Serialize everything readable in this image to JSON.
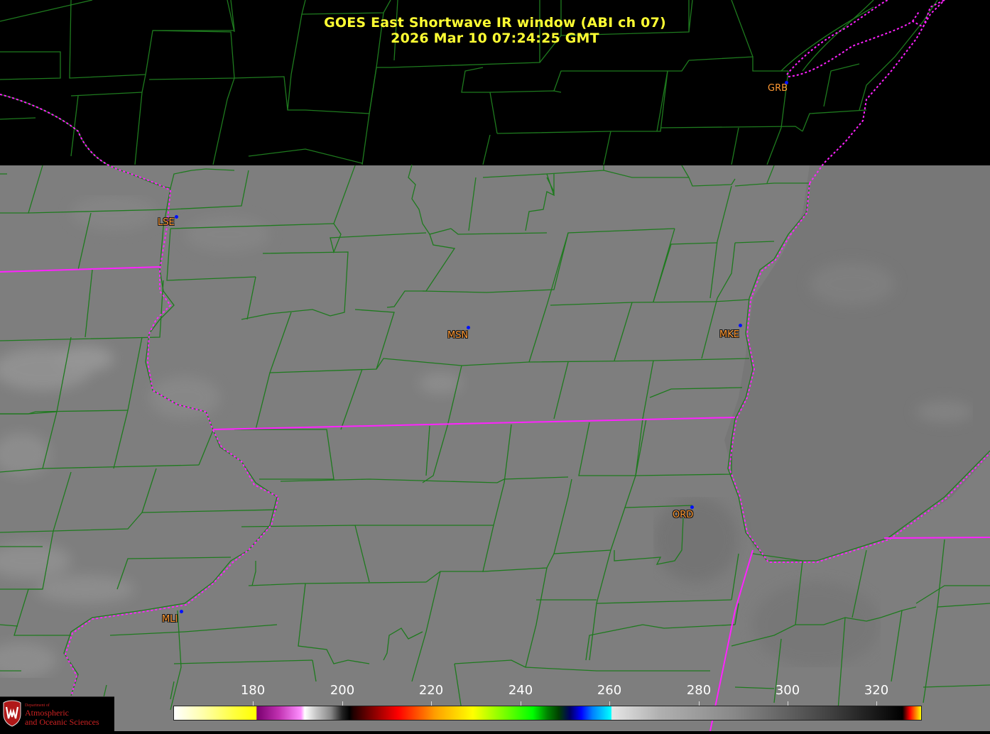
{
  "header": {
    "title": "GOES East Shortwave IR window (ABI ch 07)",
    "timestamp": "2026 Mar 10  07:24:25 GMT"
  },
  "stations": [
    {
      "id": "GRB",
      "label": "GRB"
    },
    {
      "id": "LSE",
      "label": "LSE"
    },
    {
      "id": "MSN",
      "label": "MSN"
    },
    {
      "id": "MKE",
      "label": "MKE"
    },
    {
      "id": "ORD",
      "label": "ORD"
    },
    {
      "id": "MLI",
      "label": "MLI"
    }
  ],
  "colorbar": {
    "ticks": [
      "180",
      "200",
      "220",
      "240",
      "260",
      "280",
      "300",
      "320"
    ]
  },
  "colors": {
    "title": "#ffff33",
    "county_lines": "#1e7a1e",
    "state_lines": "#ff22ff",
    "station_label": "#ff9933",
    "station_dot": "#0010ff",
    "imagery_gray": "#7d7d7d"
  },
  "logo": {
    "dept": "Department of",
    "line1": "Atmospheric",
    "line2": "and Oceanic Sciences"
  }
}
